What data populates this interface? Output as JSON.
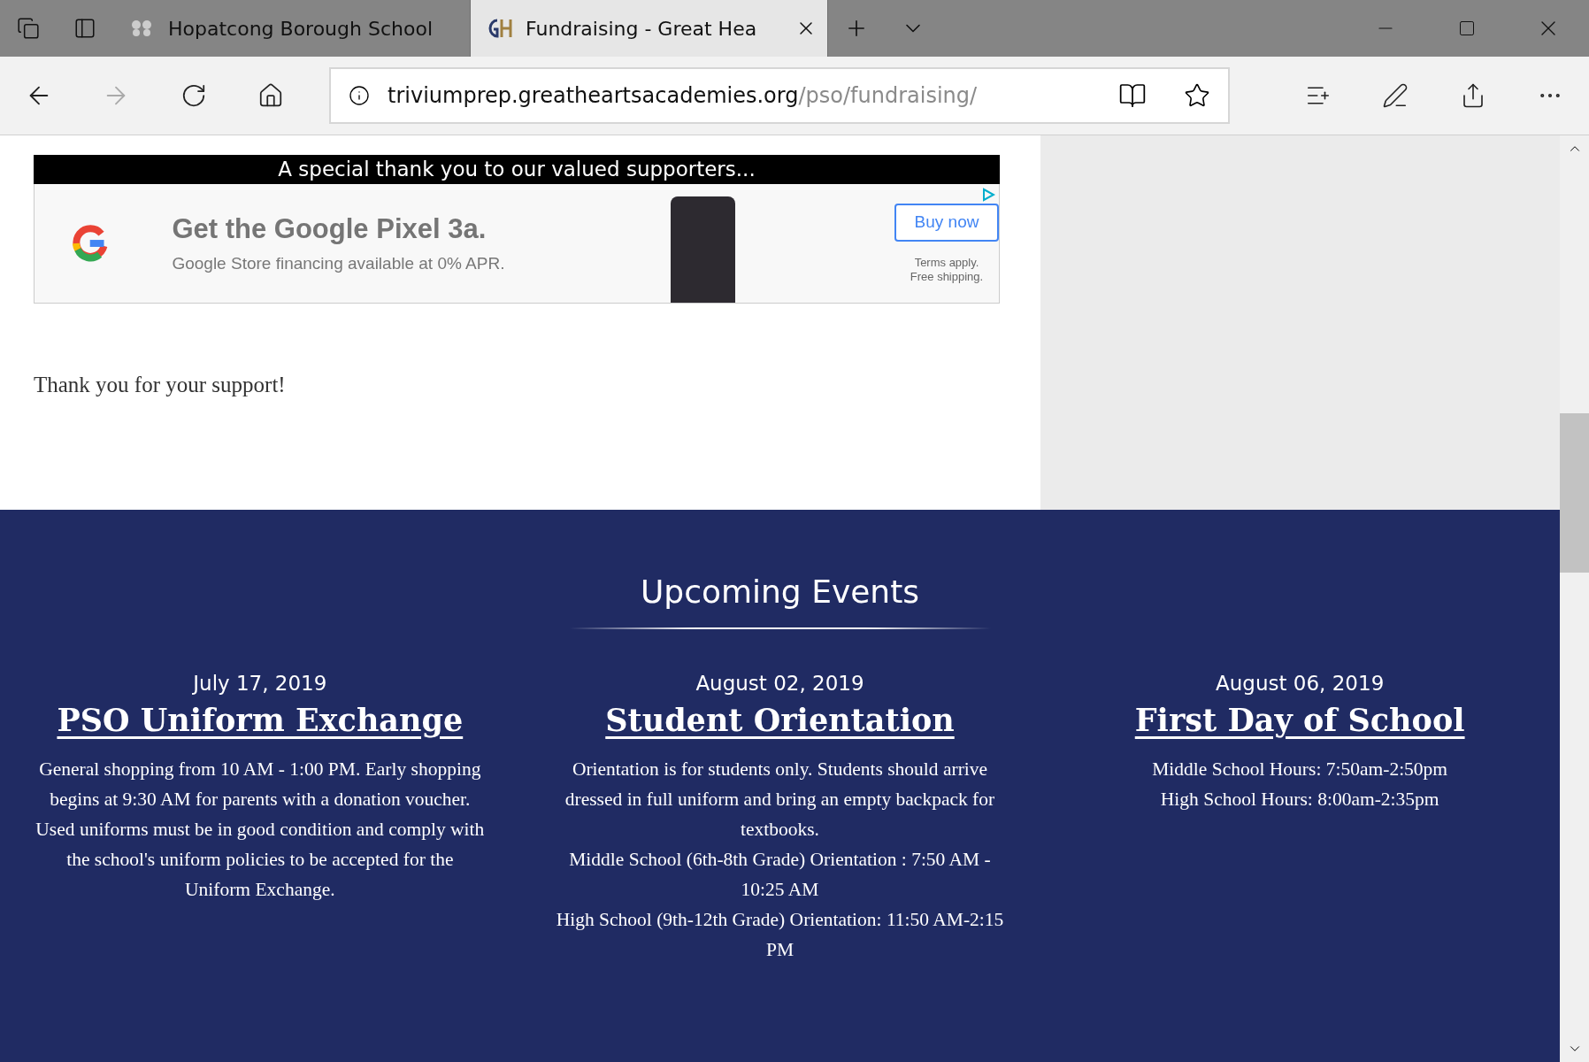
{
  "browser": {
    "tabs": [
      {
        "title": "Hopatcong Borough School",
        "selected": false
      },
      {
        "title": "Fundraising - Great Hea",
        "selected": true
      }
    ],
    "address": {
      "host": "triviumprep.greatheartsacademies.org",
      "path": "/pso/fundraising/"
    }
  },
  "supporters": {
    "heading": "A special thank you to our valued supporters...",
    "ad": {
      "headline": "Get the Google Pixel 3a.",
      "subline": "Google Store financing available at 0% APR.",
      "button": "Buy now",
      "terms": [
        "Terms apply.",
        "Free shipping."
      ]
    }
  },
  "thanks": "Thank you for your support!",
  "events": {
    "heading": "Upcoming Events",
    "items": [
      {
        "date": "July 17, 2019",
        "title": "PSO Uniform Exchange",
        "paragraphs": [
          "General shopping from 10 AM - 1:00 PM. Early shopping begins at 9:30 AM for parents with a donation voucher. Used uniforms must be in good condition and comply with the school's uniform policies to be accepted for the Uniform Exchange."
        ]
      },
      {
        "date": "August 02, 2019",
        "title": "Student Orientation",
        "paragraphs": [
          "Orientation is for students only. Students should arrive dressed in full uniform and bring an empty backpack for textbooks.",
          "Middle School (6th-8th Grade) Orientation : 7:50 AM - 10:25 AM",
          "High School (9th-12th Grade) Orientation: 11:50 AM-2:15 PM"
        ]
      },
      {
        "date": "August 06, 2019",
        "title": "First Day of School",
        "paragraphs": [
          "Middle School Hours: 7:50am-2:50pm",
          "High School Hours: 8:00am-2:35pm"
        ]
      }
    ]
  }
}
